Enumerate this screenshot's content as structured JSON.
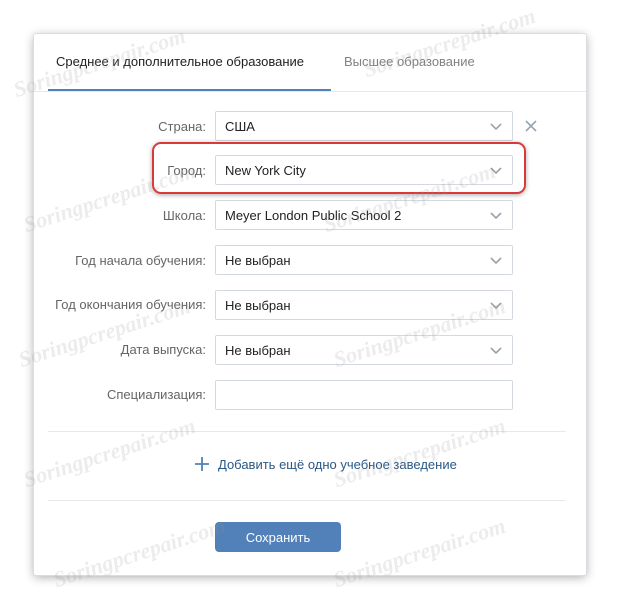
{
  "tabs": [
    {
      "label": "Среднее и дополнительное образование",
      "active": true
    },
    {
      "label": "Высшее образование",
      "active": false
    }
  ],
  "form": {
    "country": {
      "label": "Страна:",
      "value": "США"
    },
    "city": {
      "label": "Город:",
      "value": "New York City"
    },
    "school": {
      "label": "Школа:",
      "value": "Meyer London Public School 2"
    },
    "start_year": {
      "label": "Год начала обучения:",
      "value": "Не выбран"
    },
    "end_year": {
      "label": "Год окончания обучения:",
      "value": "Не выбран"
    },
    "graduation_date": {
      "label": "Дата выпуска:",
      "value": "Не выбран"
    },
    "specialization": {
      "label": "Специализация:",
      "value": ""
    }
  },
  "add_link": "Добавить ещё одно учебное заведение",
  "save_label": "Сохранить",
  "watermark": "Soringpcrepair.com",
  "colors": {
    "accent": "#5181b8",
    "link": "#2a5885",
    "highlight": "#d83a3a"
  }
}
